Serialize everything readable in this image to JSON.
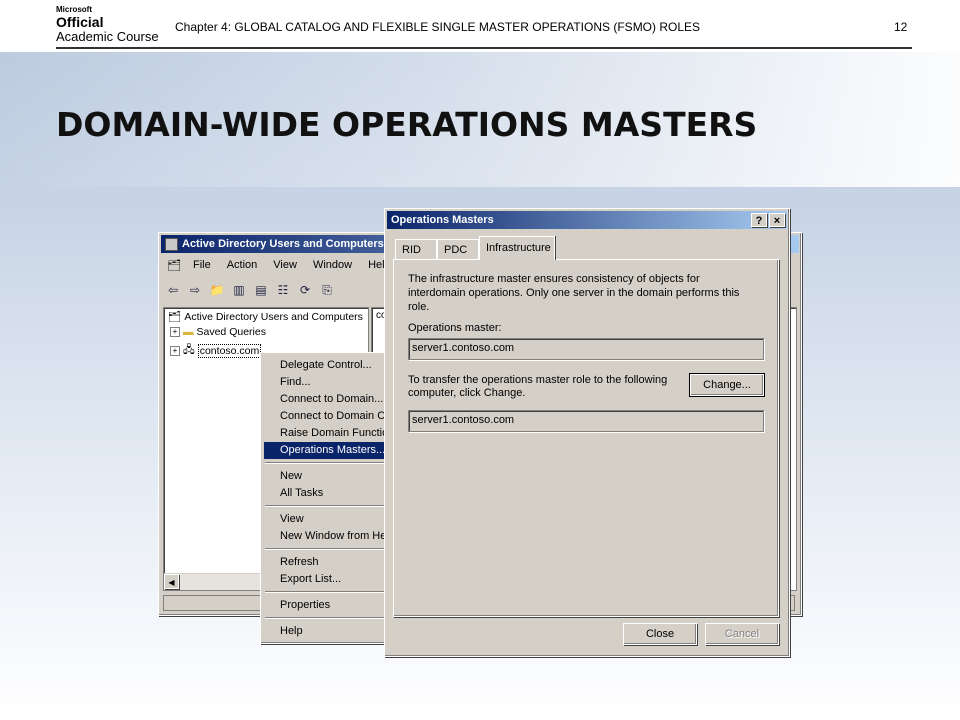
{
  "slide": {
    "logo": {
      "line1": "Microsoft",
      "line2": "Official",
      "line3": "Academic Course"
    },
    "chapter": "Chapter 4: GLOBAL CATALOG AND FLEXIBLE SINGLE MASTER OPERATIONS (FSMO) ROLES",
    "page_number": "12",
    "title": "DOMAIN-WIDE OPERATIONS MASTERS"
  },
  "aduc": {
    "title": "Active Directory Users and Computers",
    "menu": [
      "File",
      "Action",
      "View",
      "Window",
      "Help"
    ],
    "tree": {
      "root": "Active Directory Users and Computers",
      "items": [
        "Saved Queries",
        "contoso.com"
      ]
    },
    "right_header": "co"
  },
  "context_menu": {
    "items": [
      {
        "label": "Delegate Control..."
      },
      {
        "label": "Find..."
      },
      {
        "label": "Connect to Domain..."
      },
      {
        "label": "Connect to Domain Co"
      },
      {
        "label": "Raise Domain Functior"
      },
      {
        "label": "Operations Masters...",
        "selected": true
      },
      {
        "label": "New"
      },
      {
        "label": "All Tasks"
      },
      {
        "label": "View"
      },
      {
        "label": "New Window from Her"
      },
      {
        "label": "Refresh"
      },
      {
        "label": "Export List..."
      },
      {
        "label": "Properties"
      },
      {
        "label": "Help"
      }
    ]
  },
  "dialog": {
    "title": "Operations Masters",
    "help_btn": "?",
    "close_btn": "×",
    "tabs": [
      "RID",
      "PDC",
      "Infrastructure"
    ],
    "active_tab": "Infrastructure",
    "description": "The infrastructure master ensures consistency of objects for interdomain operations. Only one server in the domain performs this role.",
    "operations_master_label": "Operations master:",
    "operations_master_value": "server1.contoso.com",
    "transfer_text": "To transfer the operations master role to the following computer, click Change.",
    "change_button": "Change...",
    "target_value": "server1.contoso.com",
    "close_button": "Close",
    "cancel_button": "Cancel"
  }
}
